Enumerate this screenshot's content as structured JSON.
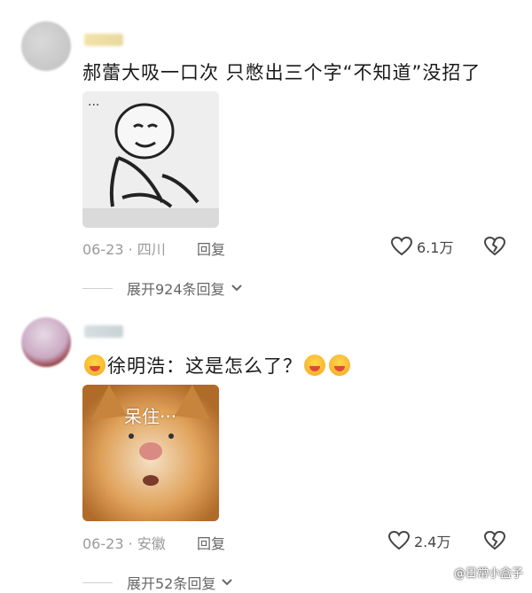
{
  "comments": [
    {
      "text": "郝蕾大吸一口次 只憋出三个字“不知道”没招了",
      "date_location": "06-23 · 四川",
      "reply_label": "回复",
      "likes": "6.1万",
      "expand_label": "展开924条回复"
    },
    {
      "text": "徐明浩：这是怎么了？",
      "date_location": "06-23 · 安徽",
      "reply_label": "回复",
      "likes": "2.4万",
      "expand_label": "展开52条回复",
      "image_caption": "呆住···"
    }
  ],
  "watermark": "@日常小盒子",
  "icons": [
    "heart-icon",
    "broken-heart-icon",
    "chevron-down-icon",
    "emoji-icon"
  ]
}
